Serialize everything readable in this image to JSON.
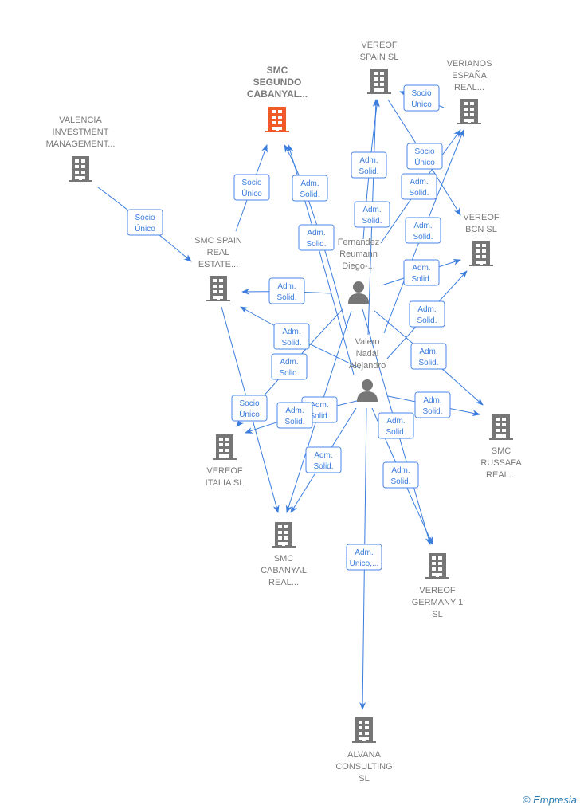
{
  "colors": {
    "accent": "#3b7ddd",
    "node": "#767676",
    "highlight": "#f05a28"
  },
  "nodes": [
    {
      "id": "segundo",
      "type": "company",
      "highlight": true,
      "lines": [
        "SMC",
        "SEGUNDO",
        "CABANYAL..."
      ]
    },
    {
      "id": "vspain",
      "type": "company",
      "lines": [
        "VEREOF",
        "SPAIN  SL"
      ]
    },
    {
      "id": "verianos",
      "type": "company",
      "lines": [
        "VERIANOS",
        "ESPAÑA",
        "REAL..."
      ]
    },
    {
      "id": "valencia",
      "type": "company",
      "lines": [
        "VALENCIA",
        "INVESTMENT",
        "MANAGEMENT..."
      ]
    },
    {
      "id": "smcspain",
      "type": "company",
      "lines": [
        "SMC SPAIN",
        "REAL",
        "ESTATE..."
      ]
    },
    {
      "id": "bcn",
      "type": "company",
      "lines": [
        "VEREOF",
        "BCN  SL"
      ]
    },
    {
      "id": "fernandez",
      "type": "person",
      "lines": [
        "Fernandez",
        "Reumann",
        "Diego-..."
      ]
    },
    {
      "id": "valero",
      "type": "person",
      "lines": [
        "Valero",
        "Nadal",
        "Alejandro"
      ]
    },
    {
      "id": "russafa",
      "type": "company",
      "lines": [
        "SMC",
        "RUSSAFA",
        "REAL..."
      ]
    },
    {
      "id": "italia",
      "type": "company",
      "lines": [
        "VEREOF",
        "ITALIA  SL"
      ]
    },
    {
      "id": "cabanyal",
      "type": "company",
      "lines": [
        "SMC",
        "CABANYAL",
        "REAL..."
      ]
    },
    {
      "id": "germany",
      "type": "company",
      "lines": [
        "VEREOF",
        "GERMANY 1",
        "SL"
      ]
    },
    {
      "id": "alvana",
      "type": "company",
      "lines": [
        "ALVANA",
        "CONSULTING",
        "SL"
      ]
    }
  ],
  "edges": [
    {
      "from": "valencia",
      "to": "smcspain",
      "label": [
        "Socio",
        "Único"
      ]
    },
    {
      "from": "smcspain",
      "to": "segundo",
      "label": [
        "Socio",
        "Único"
      ]
    },
    {
      "from": "fernandez",
      "to": "segundo",
      "label": [
        "Adm.",
        "Solid."
      ]
    },
    {
      "from": "valero",
      "to": "segundo",
      "label": [
        "Adm.",
        "Solid."
      ]
    },
    {
      "from": "fernandez",
      "to": "vspain",
      "label": [
        "Adm.",
        "Solid."
      ]
    },
    {
      "from": "valero",
      "to": "vspain",
      "label": [
        "Adm.",
        "Solid."
      ]
    },
    {
      "from": "verianos",
      "to": "vspain",
      "label": [
        "Socio",
        "Único"
      ]
    },
    {
      "from": "vspain",
      "to": "bcn",
      "label": [
        "Socio",
        "Único"
      ]
    },
    {
      "from": "fernandez",
      "to": "verianos",
      "label": [
        "Adm.",
        "Solid."
      ]
    },
    {
      "from": "valero",
      "to": "verianos",
      "label": [
        "Adm.",
        "Solid."
      ]
    },
    {
      "from": "fernandez",
      "to": "bcn",
      "label": [
        "Adm.",
        "Solid."
      ]
    },
    {
      "from": "valero",
      "to": "bcn",
      "label": [
        "Adm.",
        "Solid."
      ]
    },
    {
      "from": "fernandez",
      "to": "russafa",
      "label": [
        "Adm.",
        "Solid."
      ]
    },
    {
      "from": "valero",
      "to": "russafa",
      "label": [
        "Adm.",
        "Solid."
      ]
    },
    {
      "from": "fernandez",
      "to": "smcspain",
      "label": [
        "Adm.",
        "Solid."
      ]
    },
    {
      "from": "valero",
      "to": "smcspain",
      "label": [
        "Adm.",
        "Solid."
      ]
    },
    {
      "from": "fernandez",
      "to": "italia",
      "label": [
        "Adm.",
        "Solid."
      ]
    },
    {
      "from": "smcspain",
      "to": "cabanyal",
      "label": [
        "Socio",
        "Único"
      ]
    },
    {
      "from": "fernandez",
      "to": "cabanyal",
      "label": [
        "Adm.",
        "Solid."
      ]
    },
    {
      "from": "valero",
      "to": "italia",
      "label": [
        "Adm.",
        "Solid."
      ]
    },
    {
      "from": "valero",
      "to": "cabanyal",
      "label": [
        "Adm.",
        "Solid."
      ]
    },
    {
      "from": "fernandez",
      "to": "germany",
      "label": [
        "Adm.",
        "Solid."
      ]
    },
    {
      "from": "valero",
      "to": "germany",
      "label": [
        "Adm.",
        "Solid."
      ]
    },
    {
      "from": "valero",
      "to": "alvana",
      "label": [
        "Adm.",
        "Unico,..."
      ]
    }
  ],
  "footer": {
    "copyright": "©",
    "brand": "Empresia"
  }
}
